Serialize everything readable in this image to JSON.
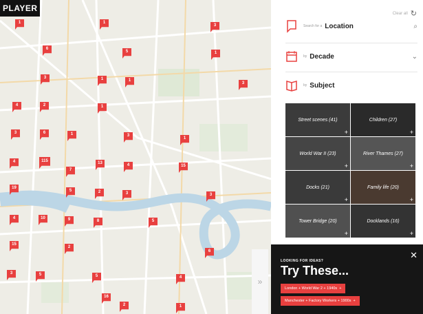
{
  "app": {
    "badge": "PLAYER",
    "accent": "#e8403f"
  },
  "map": {
    "markers": [
      {
        "label": "1"
      },
      {
        "label": "1"
      },
      {
        "label": "3"
      },
      {
        "label": "6"
      },
      {
        "label": "5"
      },
      {
        "label": "1"
      },
      {
        "label": "3"
      },
      {
        "label": "1"
      },
      {
        "label": "1"
      },
      {
        "label": "3"
      },
      {
        "label": "4"
      },
      {
        "label": "2"
      },
      {
        "label": "1"
      },
      {
        "label": "3"
      },
      {
        "label": "6"
      },
      {
        "label": "1"
      },
      {
        "label": "3"
      },
      {
        "label": "1"
      },
      {
        "label": "4"
      },
      {
        "label": "115"
      },
      {
        "label": "7"
      },
      {
        "label": "13"
      },
      {
        "label": "4"
      },
      {
        "label": "15"
      },
      {
        "label": "19"
      },
      {
        "label": "5"
      },
      {
        "label": "2"
      },
      {
        "label": "3"
      },
      {
        "label": "3"
      },
      {
        "label": "4"
      },
      {
        "label": "10"
      },
      {
        "label": "9"
      },
      {
        "label": "8"
      },
      {
        "label": "5"
      },
      {
        "label": "15"
      },
      {
        "label": "2"
      },
      {
        "label": "6"
      },
      {
        "label": "3"
      },
      {
        "label": "5"
      },
      {
        "label": "5"
      },
      {
        "label": "4"
      },
      {
        "label": "16"
      },
      {
        "label": "2"
      },
      {
        "label": "1"
      }
    ]
  },
  "panel": {
    "clear_label": "Clear all",
    "refresh_icon": "refresh-icon",
    "location": {
      "small": "Search for a",
      "label": "Location",
      "icon": "search-icon"
    },
    "decade": {
      "small": "by",
      "label": "Decade",
      "icon": "chevron-down-icon"
    },
    "subject": {
      "small": "by",
      "label": "Subject"
    },
    "tiles": [
      {
        "label": "Street scenes (41)",
        "bg": "#3b3b3b"
      },
      {
        "label": "Children (27)",
        "bg": "#2a2a2a"
      },
      {
        "label": "World War II (23)",
        "bg": "#454545"
      },
      {
        "label": "River Thames (27)",
        "bg": "#555"
      },
      {
        "label": "Docks (21)",
        "bg": "#3a3a3a"
      },
      {
        "label": "Family life (20)",
        "bg": "#4a3a30"
      },
      {
        "label": "Tower Bridge (20)",
        "bg": "#505050"
      },
      {
        "label": "Docklands (16)",
        "bg": "#333"
      }
    ]
  },
  "try": {
    "eyebrow": "LOOKING FOR IDEAS?",
    "title": "Try These...",
    "chip1": "London + World War 2 + 1940s",
    "chip2": "Manchester + Factory Workers + 1900s",
    "close": "✕"
  }
}
